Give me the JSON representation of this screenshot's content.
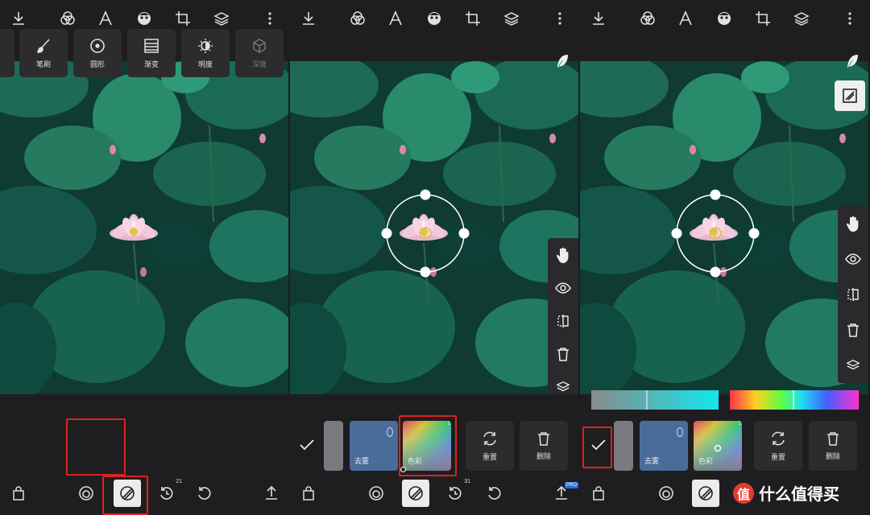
{
  "panels": [
    {
      "tools": [
        {
          "label": "笔刷",
          "icon": "brush-icon"
        },
        {
          "label": "圆形",
          "icon": "radial-target-icon"
        },
        {
          "label": "渐变",
          "icon": "gradient-icon"
        },
        {
          "label": "明度",
          "icon": "brightness-icon"
        },
        {
          "label": "深度",
          "icon": "depth-cube-icon"
        }
      ],
      "history_count": "21"
    },
    {
      "tools": [
        {
          "label": "去雾",
          "icon": "dehaze-mask"
        },
        {
          "label": "色彩",
          "icon": "color-mask"
        },
        {
          "label": "重置",
          "icon": "reset-icon"
        },
        {
          "label": "删除",
          "icon": "delete-icon"
        }
      ],
      "mask_badge": "1",
      "history_count": "31",
      "pro_badge": "PRO"
    },
    {
      "tools": [
        {
          "label": "去雾",
          "icon": "dehaze-mask"
        },
        {
          "label": "色彩",
          "icon": "color-mask"
        },
        {
          "label": "重置",
          "icon": "reset-icon"
        },
        {
          "label": "删除",
          "icon": "delete-icon"
        }
      ],
      "mask_badge": "1"
    }
  ],
  "watermark": {
    "logo_char": "值",
    "text": "什么值得买"
  },
  "colors": {
    "panel_bg": "#1e1e20",
    "highlight": "#e02020",
    "tool_bg": "#2c2c2e",
    "accent_blue": "#2b6cd9"
  }
}
